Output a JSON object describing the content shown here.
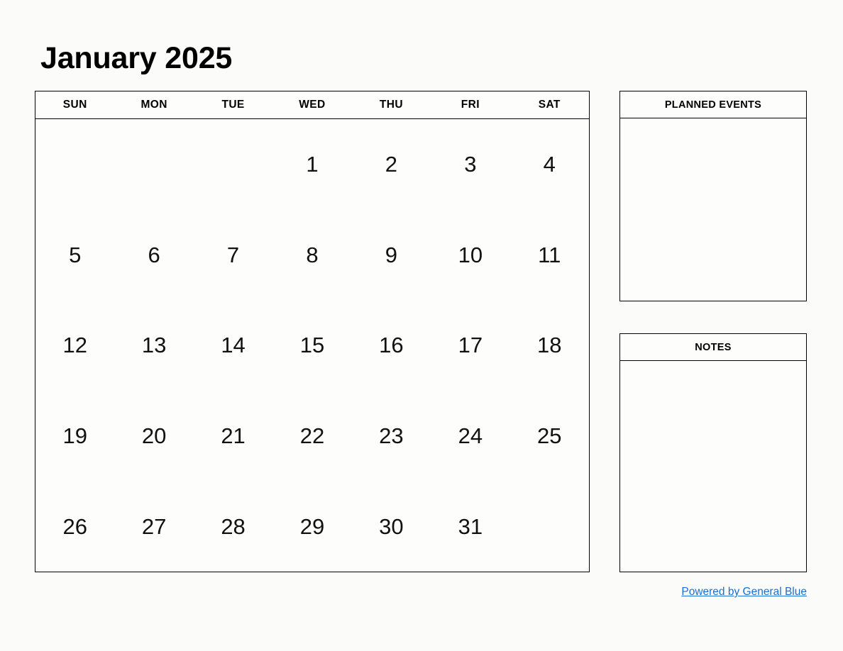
{
  "title": "January 2025",
  "calendar": {
    "weekdays": [
      "SUN",
      "MON",
      "TUE",
      "WED",
      "THU",
      "FRI",
      "SAT"
    ],
    "weeks": [
      [
        "",
        "",
        "",
        "1",
        "2",
        "3",
        "4"
      ],
      [
        "5",
        "6",
        "7",
        "8",
        "9",
        "10",
        "11"
      ],
      [
        "12",
        "13",
        "14",
        "15",
        "16",
        "17",
        "18"
      ],
      [
        "19",
        "20",
        "21",
        "22",
        "23",
        "24",
        "25"
      ],
      [
        "26",
        "27",
        "28",
        "29",
        "30",
        "31",
        ""
      ]
    ]
  },
  "panels": {
    "planned_events": {
      "header": "PLANNED EVENTS",
      "content": ""
    },
    "notes": {
      "header": "NOTES",
      "content": ""
    }
  },
  "footer": {
    "link_label": "Powered by General Blue"
  },
  "colors": {
    "background": "#fbfbfa",
    "border": "#000000",
    "text": "#000000",
    "link": "#1a6fd4"
  }
}
